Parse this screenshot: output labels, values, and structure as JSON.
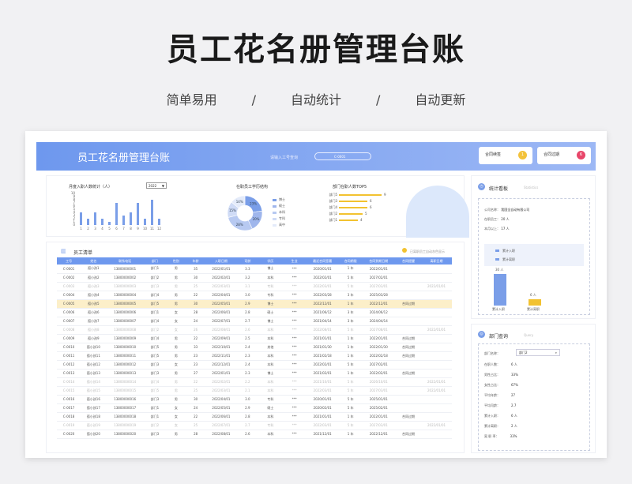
{
  "hero": {
    "title": "员工花名册管理台账",
    "features": [
      "简单易用",
      "/",
      "自动统计",
      "/",
      "自动更新"
    ]
  },
  "banner": {
    "title": "员工花名册管理台账",
    "search_label": "请输入工号查询",
    "search_value": "C-0001",
    "cards": [
      {
        "label": "合同续签",
        "badge": "1"
      },
      {
        "label": "合同过期",
        "badge": "6"
      }
    ]
  },
  "colors": {
    "primary": "#6e98ee",
    "accent": "#f2c230",
    "highlight": "#fcefc9",
    "badge_yellow": "#f3c23b",
    "badge_red": "#e8466a"
  },
  "monthly_chart": {
    "title": "月度入职人数统计（人）",
    "year": "2022",
    "chart_data": {
      "type": "bar",
      "categories": [
        "1",
        "2",
        "3",
        "4",
        "5",
        "6",
        "7",
        "8",
        "9",
        "10",
        "11",
        "12"
      ],
      "values": [
        4,
        2,
        4,
        2,
        1,
        7,
        3,
        4,
        7,
        2,
        8,
        2
      ],
      "ylim": [
        0,
        10
      ],
      "yticks": [
        "0",
        "1",
        "2",
        "3",
        "4",
        "5",
        "6",
        "7",
        "8",
        "9",
        "10"
      ]
    }
  },
  "edu_chart": {
    "title": "在职员工学历结构",
    "chart_data": {
      "type": "pie",
      "labels": [
        "博士",
        "硕士",
        "本科",
        "专科",
        "高中"
      ],
      "values": [
        23,
        20,
        28,
        15,
        14
      ],
      "value_labels": [
        "23%",
        "20%",
        "28%",
        "15%",
        "14%"
      ]
    }
  },
  "dept_chart": {
    "title": "部门在职人数TOP5",
    "chart_data": {
      "type": "bar",
      "categories": [
        "部门5",
        "部门3",
        "部门4",
        "部门2",
        "部门1"
      ],
      "values": [
        9,
        6,
        6,
        5,
        4
      ]
    }
  },
  "roster": {
    "title": "员工清单",
    "note": "已离职员工自动灰色显示",
    "columns": [
      "工号",
      "姓名",
      "联系电话",
      "部门",
      "性别",
      "年龄",
      "入职日期",
      "司龄",
      "学历",
      "生业",
      "最近合同签署",
      "合同期限",
      "合同到期日期",
      "合同提醒",
      "离职日期"
    ],
    "rows": [
      {
        "c": [
          "C-0001",
          "孤小孩1",
          "13800000001",
          "部门1",
          "男",
          "35",
          "2022/01/01",
          "3.3",
          "博士",
          "***",
          "2020/01/01",
          "1 年",
          "2022/01/01",
          "",
          ""
        ],
        "s": ""
      },
      {
        "c": [
          "C-0002",
          "孤小孩2",
          "13800000002",
          "部门2",
          "男",
          "30",
          "2022/02/01",
          "3.2",
          "本科",
          "***",
          "2022/02/01",
          "5 年",
          "2027/02/01",
          "",
          ""
        ],
        "s": ""
      },
      {
        "c": [
          "C-0003",
          "孤小孩3",
          "13800000003",
          "部门3",
          "男",
          "25",
          "2022/03/01",
          "3.1",
          "专科",
          "***",
          "2022/03/01",
          "5 年",
          "2027/03/01",
          "",
          "2022/01/01"
        ],
        "s": "faded"
      },
      {
        "c": [
          "C-0004",
          "孤小孩4",
          "13800000004",
          "部门4",
          "男",
          "22",
          "2022/04/01",
          "3.0",
          "专科",
          "***",
          "2022/03/28",
          "3 年",
          "2025/03/28",
          "",
          ""
        ],
        "s": ""
      },
      {
        "c": [
          "C-0005",
          "孤小孩5",
          "13800000005",
          "部门5",
          "男",
          "30",
          "2022/05/01",
          "2.9",
          "博士",
          "***",
          "2022/12/01",
          "1 年",
          "2022/12/01",
          "合同过期",
          ""
        ],
        "s": "hl"
      },
      {
        "c": [
          "C-0006",
          "孤小孩6",
          "13800000006",
          "部门1",
          "女",
          "28",
          "2022/06/01",
          "2.8",
          "硕士",
          "***",
          "2021/06/12",
          "3 年",
          "2024/06/12",
          "",
          ""
        ],
        "s": ""
      },
      {
        "c": [
          "C-0007",
          "孤小孩7",
          "13800000007",
          "部门4",
          "女",
          "24",
          "2022/07/01",
          "2.7",
          "博士",
          "***",
          "2021/04/14",
          "3 年",
          "2024/04/14",
          "",
          ""
        ],
        "s": ""
      },
      {
        "c": [
          "C-0008",
          "孤小孩8",
          "13800000008",
          "部门2",
          "女",
          "26",
          "2022/08/01",
          "2.6",
          "本科",
          "***",
          "2022/08/01",
          "5 年",
          "2027/08/01",
          "",
          "2022/01/01"
        ],
        "s": "faded"
      },
      {
        "c": [
          "C-0009",
          "孤小孩9",
          "13800000009",
          "部门4",
          "男",
          "22",
          "2022/09/01",
          "2.5",
          "本科",
          "***",
          "2021/01/01",
          "1 年",
          "2022/01/01",
          "合同过期",
          ""
        ],
        "s": ""
      },
      {
        "c": [
          "C-0010",
          "孤小孩10",
          "13800000010",
          "部门5",
          "男",
          "33",
          "2022/10/01",
          "2.4",
          "其他",
          "***",
          "2021/01/30",
          "1 年",
          "2022/01/30",
          "合同过期",
          ""
        ],
        "s": ""
      },
      {
        "c": [
          "C-0011",
          "孤小孩11",
          "13800000011",
          "部门5",
          "男",
          "23",
          "2022/11/01",
          "2.3",
          "本科",
          "***",
          "2021/02/18",
          "1 年",
          "2022/02/18",
          "合同过期",
          ""
        ],
        "s": ""
      },
      {
        "c": [
          "C-0012",
          "孤小孩12",
          "13800000012",
          "部门3",
          "女",
          "23",
          "2022/12/01",
          "2.4",
          "本科",
          "***",
          "2022/02/01",
          "5 年",
          "2027/02/01",
          "",
          ""
        ],
        "s": ""
      },
      {
        "c": [
          "C-0013",
          "孤小孩13",
          "13800000013",
          "部门3",
          "男",
          "27",
          "2022/01/01",
          "2.3",
          "博士",
          "***",
          "2021/02/01",
          "1 年",
          "2022/02/01",
          "合同过期",
          ""
        ],
        "s": ""
      },
      {
        "c": [
          "C-0014",
          "孤小孩14",
          "13800000014",
          "部门4",
          "男",
          "22",
          "2022/02/01",
          "2.2",
          "本科",
          "***",
          "2021/10/01",
          "5 年",
          "2026/10/01",
          "",
          "2022/01/01"
        ],
        "s": "faded"
      },
      {
        "c": [
          "C-0015",
          "孤小孩15",
          "13800000015",
          "部门5",
          "男",
          "25",
          "2022/03/01",
          "2.1",
          "本科",
          "***",
          "2022/03/01",
          "5 年",
          "2027/03/01",
          "",
          "2022/01/01"
        ],
        "s": "faded"
      },
      {
        "c": [
          "C-0016",
          "孤小孩16",
          "13800000016",
          "部门3",
          "男",
          "30",
          "2022/04/01",
          "3.0",
          "专科",
          "***",
          "2020/01/01",
          "5 年",
          "2025/01/01",
          "",
          ""
        ],
        "s": ""
      },
      {
        "c": [
          "C-0017",
          "孤小孩17",
          "13800000017",
          "部门1",
          "女",
          "24",
          "2022/05/01",
          "2.9",
          "硕士",
          "***",
          "2020/02/01",
          "5 年",
          "2025/02/01",
          "",
          ""
        ],
        "s": ""
      },
      {
        "c": [
          "C-0018",
          "孤小孩18",
          "13800000018",
          "部门1",
          "女",
          "22",
          "2022/06/01",
          "2.8",
          "本科",
          "***",
          "2021/01/01",
          "1 年",
          "2022/01/01",
          "合同过期",
          ""
        ],
        "s": ""
      },
      {
        "c": [
          "C-0019",
          "孤小孩19",
          "13800000019",
          "部门2",
          "女",
          "25",
          "2022/07/01",
          "2.7",
          "专科",
          "***",
          "2022/03/01",
          "5 年",
          "2027/03/01",
          "",
          "2022/01/01"
        ],
        "s": "faded"
      },
      {
        "c": [
          "C-0020",
          "孤小孩20",
          "13800000020",
          "部门3",
          "男",
          "28",
          "2022/08/01",
          "2.6",
          "本科",
          "***",
          "2021/12/01",
          "1 年",
          "2022/12/01",
          "合同过期",
          ""
        ],
        "s": ""
      }
    ]
  },
  "stats_panel": {
    "title": "统计看板",
    "title_en": "Statistics",
    "company_label": "公司名称：",
    "company_value": "我国全自动有限公司",
    "active_label": "在职员工：",
    "active_value": "20 人",
    "month_label": "本月以上：",
    "month_value": "17 人",
    "legend_join": "累计入职",
    "legend_leave": "累计离职",
    "join_count": "30 人",
    "leave_count": "6 人",
    "join_value": 30,
    "leave_value": 6
  },
  "dept_panel": {
    "title": "部门查询",
    "title_en": "Query",
    "dept_label": "部门名称：",
    "dept_value": "部门2",
    "rows": [
      {
        "k": "在职人数：",
        "v": "6 人"
      },
      {
        "k": "男性占比：",
        "v": "33%"
      },
      {
        "k": "女性占比：",
        "v": "67%"
      },
      {
        "k": "平均年龄：",
        "v": "27"
      },
      {
        "k": "平均司龄：",
        "v": "2.7"
      },
      {
        "k": "累计入职：",
        "v": "6 人"
      },
      {
        "k": "累计离职：",
        "v": "2 人"
      },
      {
        "k": "离 职 率：",
        "v": "33%"
      }
    ]
  }
}
